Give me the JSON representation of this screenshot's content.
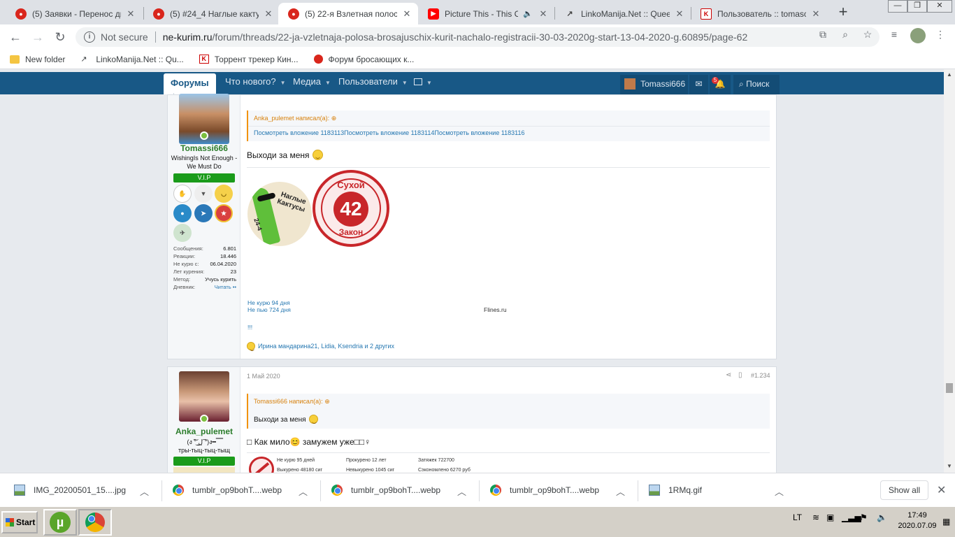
{
  "tabs": [
    {
      "title": "(5) Заявки - Перенос дне",
      "icon": "forum-icon",
      "active": false
    },
    {
      "title": "(5) #24_4 Наглые кактусы",
      "icon": "forum-icon",
      "active": false
    },
    {
      "title": "(5) 22-я Взлетная полоса",
      "icon": "forum-icon",
      "active": true
    },
    {
      "title": "Picture This - This Chris",
      "icon": "youtube-icon",
      "active": false
    },
    {
      "title": "LinkoManija.Net :: Queen c",
      "icon": "linkomanija-icon",
      "active": false
    },
    {
      "title": "Пользователь :: tomasce",
      "icon": "kinozal-icon",
      "active": false
    }
  ],
  "address": {
    "security": "Not secure",
    "host": "ne-kurim.ru",
    "path": "/forum/threads/22-ja-vzletnaja-polosa-brosajuschix-kurit-nachalo-registracii-30-03-2020g-start-13-04-2020-g.60895/page-62"
  },
  "bookmarks": [
    {
      "label": "New folder",
      "icon": "folder-icon"
    },
    {
      "label": "LinkoManija.Net :: Qu...",
      "icon": "linkomanija-icon"
    },
    {
      "label": "Торрент трекер Кин...",
      "icon": "kinozal-icon"
    },
    {
      "label": "Форум бросающих к...",
      "icon": "forum-icon"
    }
  ],
  "forum_nav": {
    "items": [
      "Форумы",
      "Что нового?",
      "Медиа",
      "Пользователи"
    ],
    "user": "Tomassi666",
    "alerts_count": "5",
    "search": "Поиск"
  },
  "post1": {
    "username": "Tomassi666",
    "user_title": "WishingIs Not Enough - We Must Do",
    "rank": "V.I.P",
    "stats": [
      {
        "label": "Сообщения:",
        "value": "6.801"
      },
      {
        "label": "Реакции:",
        "value": "18.446"
      },
      {
        "label": "Не курю с:",
        "value": "06.04.2020"
      },
      {
        "label": "Лет курения:",
        "value": "23"
      },
      {
        "label": "Метод:",
        "value": "Учусь курить"
      },
      {
        "label": "Дневник:",
        "value": "Читать ••"
      }
    ],
    "quote_author": "Anka_pulemet написал(а):",
    "quote_links": "Посмотреть вложение 1183113Посмотреть вложение 1183114Посмотреть вложение 1183116",
    "text": "Выходи за меня",
    "img1_text": "Наглые Кактусы",
    "img1_num": "24-4",
    "img2_top": "Сухой",
    "img2_num": "42",
    "img2_bottom": "Закон",
    "sig_line1": "Не курю  94 дня",
    "sig_line2": "Не пью 724 дня",
    "sig_site": "Flines.ru",
    "sig_extra": "!!!",
    "reactions": "Ирина мандарина21, Lidia, Ksendria и 2 других"
  },
  "post2": {
    "username": "Anka_pulemet",
    "user_title_1": "(ง ͠° ͟ل͜ ͡°)ง━ ̿̿ ̿ ̿",
    "user_title_2": "тры-тыц-тыц-тыщ",
    "rank": "V.I.P",
    "date": "1 Май 2020",
    "post_number": "#1.234",
    "quote_author": "Tomassi666 написал(а):",
    "quote_text": "Выходи за меня",
    "text": "□ Как мило😊 замужем уже□□♀",
    "ticker": [
      "Не курю 95 дней",
      "Прокурено 12 лет",
      "Затяжек 722700",
      "Выкурено 48180 сиг",
      "Невыкурено 1045 сиг",
      "Сэкономлено 6270 руб"
    ]
  },
  "downloads": [
    {
      "name": "IMG_20200501_15....jpg",
      "icon": "image-file-icon"
    },
    {
      "name": "tumblr_op9bohT....webp",
      "icon": "chrome-icon"
    },
    {
      "name": "tumblr_op9bohT....webp",
      "icon": "chrome-icon"
    },
    {
      "name": "tumblr_op9bohT....webp",
      "icon": "chrome-icon"
    },
    {
      "name": "1RMq.gif",
      "icon": "image-file-icon"
    }
  ],
  "show_all": "Show all",
  "taskbar": {
    "start": "Start",
    "lang": "LT",
    "time": "17:49",
    "date": "2020.07.09"
  },
  "colors": {
    "nav_bg": "#185886",
    "vip_green": "#1a9b1a",
    "quote_orange": "#d7810c",
    "link_blue": "#2577b1"
  }
}
